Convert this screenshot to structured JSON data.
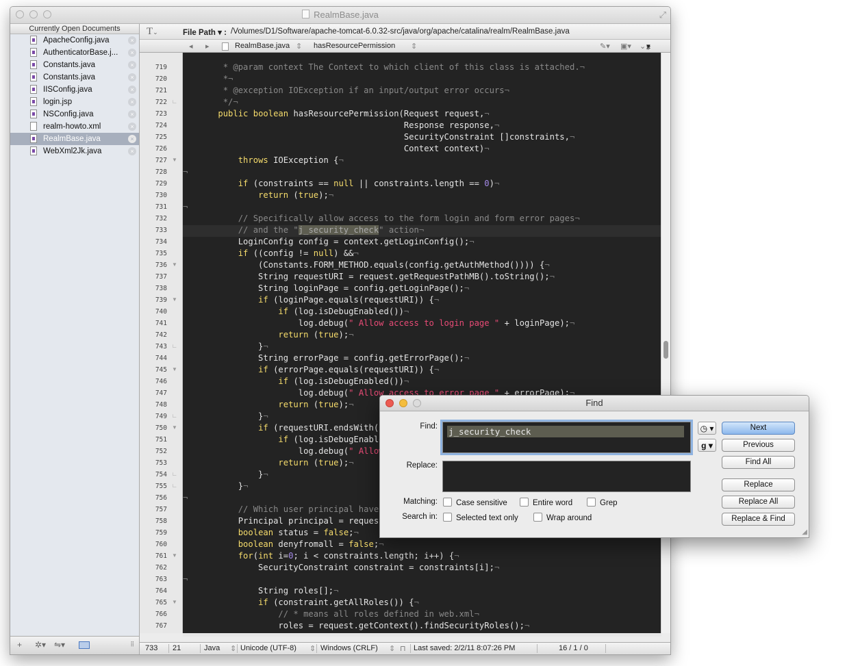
{
  "window": {
    "title": "RealmBase.java"
  },
  "sidebar": {
    "header": "Currently Open Documents",
    "items": [
      {
        "label": "ApacheConfig.java",
        "type": "java"
      },
      {
        "label": "AuthenticatorBase.j...",
        "type": "java"
      },
      {
        "label": "Constants.java",
        "type": "java"
      },
      {
        "label": "Constants.java",
        "type": "java"
      },
      {
        "label": "IISConfig.java",
        "type": "java"
      },
      {
        "label": "login.jsp",
        "type": "java"
      },
      {
        "label": "NSConfig.java",
        "type": "java"
      },
      {
        "label": "realm-howto.xml",
        "type": "xml"
      },
      {
        "label": "RealmBase.java",
        "type": "java",
        "selected": true
      },
      {
        "label": "WebXml2Jk.java",
        "type": "java"
      }
    ],
    "footer": {
      "add": "+",
      "gear": "✲▾",
      "action": "⇋▾"
    }
  },
  "pathbar": {
    "label": "File Path ▾ :",
    "value": "/Volumes/D1/Software/apache-tomcat-6.0.32-src/java/org/apache/catalina/realm/RealmBase.java"
  },
  "navbar": {
    "file": "RealmBase.java",
    "function": "hasResourcePermission",
    "hash": "#"
  },
  "editor": {
    "current_line": 733,
    "lines": [
      {
        "n": "719",
        "f": "",
        "t": "        * @param context The Context to which client of this class is attached.¬",
        "c": "comment"
      },
      {
        "n": "720",
        "f": "",
        "t": "        *¬",
        "c": "comment"
      },
      {
        "n": "721",
        "f": "",
        "t": "        * @exception IOException if an input/output error occurs¬",
        "c": "comment"
      },
      {
        "n": "722",
        "f": "end",
        "t": "        */¬",
        "c": "comment"
      },
      {
        "n": "723",
        "f": "",
        "t": "       public boolean hasResourcePermission(Request request,¬",
        "c": "code"
      },
      {
        "n": "724",
        "f": "",
        "t": "                                            Response response,¬",
        "c": "code"
      },
      {
        "n": "725",
        "f": "",
        "t": "                                            SecurityConstraint []constraints,¬",
        "c": "code"
      },
      {
        "n": "726",
        "f": "",
        "t": "                                            Context context)¬",
        "c": "code"
      },
      {
        "n": "727",
        "f": "open",
        "t": "           throws IOException {¬",
        "c": "code"
      },
      {
        "n": "728",
        "f": "",
        "t": "¬",
        "c": "inv"
      },
      {
        "n": "729",
        "f": "",
        "t": "           if (constraints == null || constraints.length == 0)¬",
        "c": "code"
      },
      {
        "n": "730",
        "f": "",
        "t": "               return (true);¬",
        "c": "code"
      },
      {
        "n": "731",
        "f": "",
        "t": "¬",
        "c": "inv"
      },
      {
        "n": "732",
        "f": "",
        "t": "           // Specifically allow access to the form login and form error pages¬",
        "c": "comment"
      },
      {
        "n": "733",
        "f": "",
        "t": "           // and the \"j_security_check\" action¬",
        "c": "comment"
      },
      {
        "n": "734",
        "f": "",
        "t": "           LoginConfig config = context.getLoginConfig();¬",
        "c": "code"
      },
      {
        "n": "735",
        "f": "",
        "t": "           if ((config != null) &&¬",
        "c": "code"
      },
      {
        "n": "736",
        "f": "open",
        "t": "               (Constants.FORM_METHOD.equals(config.getAuthMethod()))) {¬",
        "c": "code"
      },
      {
        "n": "737",
        "f": "",
        "t": "               String requestURI = request.getRequestPathMB().toString();¬",
        "c": "code"
      },
      {
        "n": "738",
        "f": "",
        "t": "               String loginPage = config.getLoginPage();¬",
        "c": "code"
      },
      {
        "n": "739",
        "f": "open",
        "t": "               if (loginPage.equals(requestURI)) {¬",
        "c": "code"
      },
      {
        "n": "740",
        "f": "",
        "t": "                   if (log.isDebugEnabled())¬",
        "c": "code"
      },
      {
        "n": "741",
        "f": "",
        "t": "                       log.debug(\" Allow access to login page \" + loginPage);¬",
        "c": "code"
      },
      {
        "n": "742",
        "f": "",
        "t": "                   return (true);¬",
        "c": "code"
      },
      {
        "n": "743",
        "f": "end",
        "t": "               }¬",
        "c": "code"
      },
      {
        "n": "744",
        "f": "",
        "t": "               String errorPage = config.getErrorPage();¬",
        "c": "code"
      },
      {
        "n": "745",
        "f": "open",
        "t": "               if (errorPage.equals(requestURI)) {¬",
        "c": "code"
      },
      {
        "n": "746",
        "f": "",
        "t": "                   if (log.isDebugEnabled())¬",
        "c": "code"
      },
      {
        "n": "747",
        "f": "",
        "t": "                       log.debug(\" Allow access to error page \" + errorPage);¬",
        "c": "code"
      },
      {
        "n": "748",
        "f": "",
        "t": "                   return (true);¬",
        "c": "code"
      },
      {
        "n": "749",
        "f": "end",
        "t": "               }¬",
        "c": "code"
      },
      {
        "n": "750",
        "f": "open",
        "t": "               if (requestURI.endsWith(Con",
        "c": "code"
      },
      {
        "n": "751",
        "f": "",
        "t": "                   if (log.isDebugEnabled(",
        "c": "code"
      },
      {
        "n": "752",
        "f": "",
        "t": "                       log.debug(\" Allow a",
        "c": "code"
      },
      {
        "n": "753",
        "f": "",
        "t": "                   return (true);¬",
        "c": "code"
      },
      {
        "n": "754",
        "f": "end",
        "t": "               }¬",
        "c": "code"
      },
      {
        "n": "755",
        "f": "end",
        "t": "           }¬",
        "c": "code"
      },
      {
        "n": "756",
        "f": "",
        "t": "¬",
        "c": "inv"
      },
      {
        "n": "757",
        "f": "",
        "t": "           // Which user principal have we",
        "c": "comment"
      },
      {
        "n": "758",
        "f": "",
        "t": "           Principal principal = request.g",
        "c": "code"
      },
      {
        "n": "759",
        "f": "",
        "t": "           boolean status = false;¬",
        "c": "code"
      },
      {
        "n": "760",
        "f": "",
        "t": "           boolean denyfromall = false;¬",
        "c": "code"
      },
      {
        "n": "761",
        "f": "open",
        "t": "           for(int i=0; i < constraints.length; i++) {¬",
        "c": "code"
      },
      {
        "n": "762",
        "f": "",
        "t": "               SecurityConstraint constraint = constraints[i];¬",
        "c": "code"
      },
      {
        "n": "763",
        "f": "",
        "t": "¬",
        "c": "inv"
      },
      {
        "n": "764",
        "f": "",
        "t": "               String roles[];¬",
        "c": "code"
      },
      {
        "n": "765",
        "f": "open",
        "t": "               if (constraint.getAllRoles()) {¬",
        "c": "code"
      },
      {
        "n": "766",
        "f": "",
        "t": "                   // * means all roles defined in web.xml¬",
        "c": "comment"
      },
      {
        "n": "767",
        "f": "",
        "t": "                   roles = request.getContext().findSecurityRoles();¬",
        "c": "code"
      }
    ]
  },
  "status": {
    "line": "733",
    "column": "21",
    "language": "Java",
    "encoding": "Unicode (UTF-8)",
    "line_endings": "Windows (CRLF)",
    "last_saved": "Last saved: 2/2/11 8:07:26 PM",
    "counts": "16 / 1 / 0"
  },
  "find": {
    "title": "Find",
    "find_label": "Find:",
    "find_value": "j_security_check",
    "replace_label": "Replace:",
    "replace_value": "",
    "history_label": "◷ ▾",
    "grep_label": "g ▾",
    "buttons": {
      "next": "Next",
      "previous": "Previous",
      "find_all": "Find All",
      "replace": "Replace",
      "replace_all": "Replace All",
      "replace_find": "Replace & Find"
    },
    "matching_label": "Matching:",
    "search_in_label": "Search in:",
    "options": {
      "case_sensitive": "Case sensitive",
      "entire_word": "Entire word",
      "grep": "Grep",
      "selected_text": "Selected text only",
      "wrap_around": "Wrap around"
    }
  },
  "colors": {
    "editor_bg": "#232323",
    "keyword": "#f6dc6c",
    "string": "#e84b76",
    "number": "#a48ae8",
    "comment": "#8a8a8a",
    "selection": "#5d5d50"
  }
}
